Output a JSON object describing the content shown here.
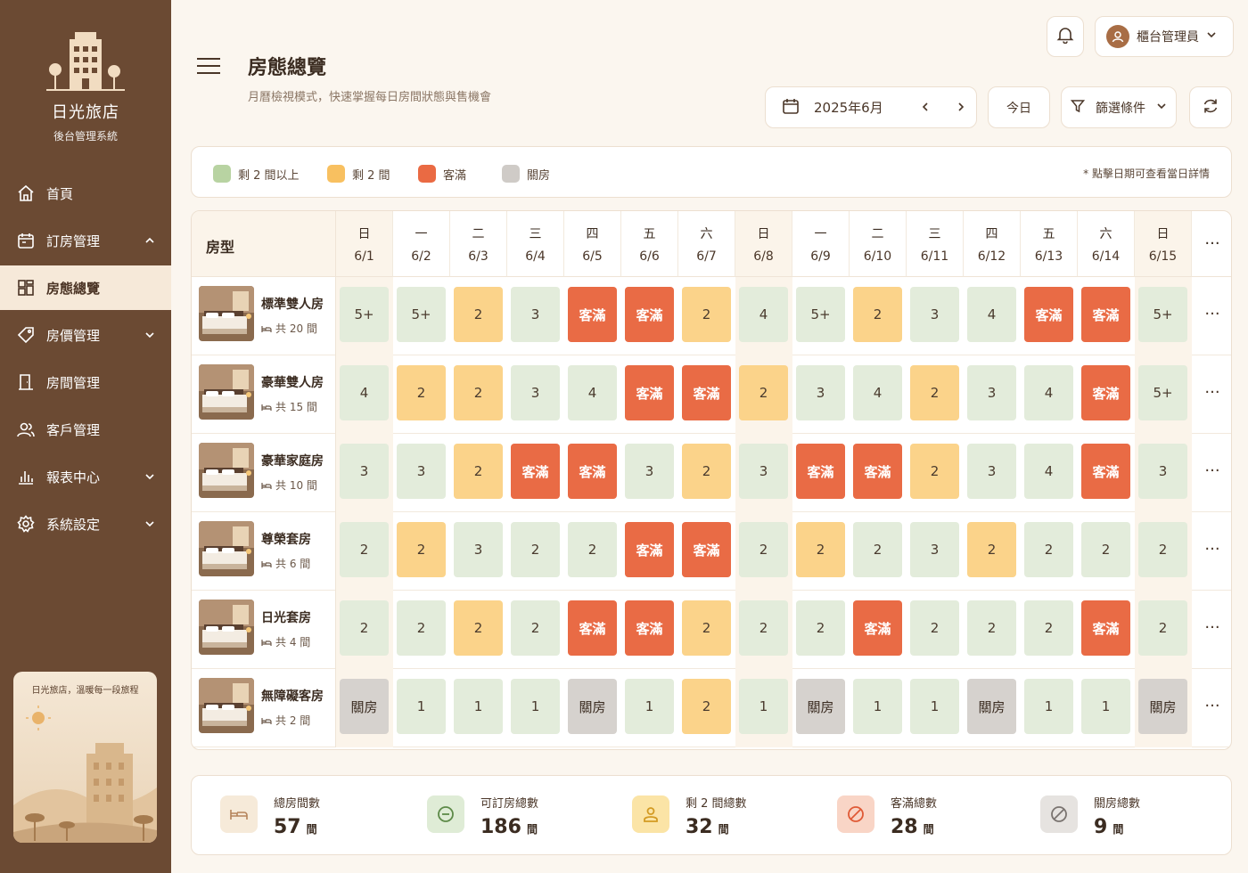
{
  "sidebar": {
    "brand_name": "日光旅店",
    "brand_sub": "後台管理系統",
    "items": [
      {
        "label": "首頁",
        "icon": "home-icon",
        "expand": false
      },
      {
        "label": "訂房管理",
        "icon": "calendar-icon",
        "expand": true
      },
      {
        "label": "房態總覽",
        "icon": "grid-icon",
        "active": true
      },
      {
        "label": "房價管理",
        "icon": "tag-icon",
        "expand": true
      },
      {
        "label": "房間管理",
        "icon": "door-icon",
        "expand": false
      },
      {
        "label": "客戶管理",
        "icon": "users-icon",
        "expand": false
      },
      {
        "label": "報表中心",
        "icon": "chart-icon",
        "expand": true
      },
      {
        "label": "系統設定",
        "icon": "gear-icon",
        "expand": true
      }
    ],
    "promo_text": "日光旅店，溫暖每一段旅程"
  },
  "header": {
    "title": "房態總覽",
    "subtitle": "月曆檢視模式，快速掌握每日房間狀態與售機會",
    "user_name": "櫃台管理員",
    "month": "2025年6月",
    "today_label": "今日",
    "filter_label": "篩選條件"
  },
  "legend": {
    "items": [
      {
        "label": "剩 2 間以上",
        "color": "#b8d3a2"
      },
      {
        "label": "剩 2 間",
        "color": "#f8c060"
      },
      {
        "label": "客滿",
        "color": "#ea6a43"
      },
      {
        "label": "關房",
        "color": "#cfcbc7"
      }
    ],
    "note": "* 點擊日期可查看當日詳情"
  },
  "grid": {
    "room_type_header": "房型",
    "days": [
      {
        "weekday": "日",
        "date": "6/1"
      },
      {
        "weekday": "一",
        "date": "6/2"
      },
      {
        "weekday": "二",
        "date": "6/3"
      },
      {
        "weekday": "三",
        "date": "6/4"
      },
      {
        "weekday": "四",
        "date": "6/5"
      },
      {
        "weekday": "五",
        "date": "6/6"
      },
      {
        "weekday": "六",
        "date": "6/7"
      },
      {
        "weekday": "日",
        "date": "6/8"
      },
      {
        "weekday": "一",
        "date": "6/9"
      },
      {
        "weekday": "二",
        "date": "6/10"
      },
      {
        "weekday": "三",
        "date": "6/11"
      },
      {
        "weekday": "四",
        "date": "6/12"
      },
      {
        "weekday": "五",
        "date": "6/13"
      },
      {
        "weekday": "六",
        "date": "6/14"
      },
      {
        "weekday": "日",
        "date": "6/15"
      }
    ],
    "more": "···",
    "rooms": [
      {
        "name": "標準雙人房",
        "count": "共 20 間",
        "cells": [
          [
            "5+",
            "avail"
          ],
          [
            "5+",
            "avail"
          ],
          [
            "2",
            "low"
          ],
          [
            "3",
            "avail"
          ],
          [
            "客滿",
            "full"
          ],
          [
            "客滿",
            "full"
          ],
          [
            "2",
            "low"
          ],
          [
            "4",
            "avail"
          ],
          [
            "5+",
            "avail"
          ],
          [
            "2",
            "low"
          ],
          [
            "3",
            "avail"
          ],
          [
            "4",
            "avail"
          ],
          [
            "客滿",
            "full"
          ],
          [
            "客滿",
            "full"
          ],
          [
            "5+",
            "avail"
          ]
        ]
      },
      {
        "name": "豪華雙人房",
        "count": "共 15 間",
        "cells": [
          [
            "4",
            "avail"
          ],
          [
            "2",
            "low"
          ],
          [
            "2",
            "low"
          ],
          [
            "3",
            "avail"
          ],
          [
            "4",
            "avail"
          ],
          [
            "客滿",
            "full"
          ],
          [
            "客滿",
            "full"
          ],
          [
            "2",
            "low"
          ],
          [
            "3",
            "avail"
          ],
          [
            "4",
            "avail"
          ],
          [
            "2",
            "low"
          ],
          [
            "3",
            "avail"
          ],
          [
            "4",
            "avail"
          ],
          [
            "客滿",
            "full"
          ],
          [
            "5+",
            "avail"
          ]
        ]
      },
      {
        "name": "豪華家庭房",
        "count": "共 10 間",
        "cells": [
          [
            "3",
            "avail"
          ],
          [
            "3",
            "avail"
          ],
          [
            "2",
            "low"
          ],
          [
            "客滿",
            "full"
          ],
          [
            "客滿",
            "full"
          ],
          [
            "3",
            "avail"
          ],
          [
            "2",
            "low"
          ],
          [
            "3",
            "avail"
          ],
          [
            "客滿",
            "full"
          ],
          [
            "客滿",
            "full"
          ],
          [
            "2",
            "low"
          ],
          [
            "3",
            "avail"
          ],
          [
            "4",
            "avail"
          ],
          [
            "客滿",
            "full"
          ],
          [
            "3",
            "avail"
          ]
        ]
      },
      {
        "name": "尊榮套房",
        "count": "共 6 間",
        "cells": [
          [
            "2",
            "avail"
          ],
          [
            "2",
            "low"
          ],
          [
            "3",
            "avail"
          ],
          [
            "2",
            "avail"
          ],
          [
            "2",
            "avail"
          ],
          [
            "客滿",
            "full"
          ],
          [
            "客滿",
            "full"
          ],
          [
            "2",
            "avail"
          ],
          [
            "2",
            "low"
          ],
          [
            "2",
            "avail"
          ],
          [
            "3",
            "avail"
          ],
          [
            "2",
            "low"
          ],
          [
            "2",
            "avail"
          ],
          [
            "2",
            "avail"
          ],
          [
            "2",
            "avail"
          ]
        ]
      },
      {
        "name": "日光套房",
        "count": "共 4 間",
        "cells": [
          [
            "2",
            "avail"
          ],
          [
            "2",
            "avail"
          ],
          [
            "2",
            "low"
          ],
          [
            "2",
            "avail"
          ],
          [
            "客滿",
            "full"
          ],
          [
            "客滿",
            "full"
          ],
          [
            "2",
            "low"
          ],
          [
            "2",
            "avail"
          ],
          [
            "2",
            "avail"
          ],
          [
            "客滿",
            "full"
          ],
          [
            "2",
            "avail"
          ],
          [
            "2",
            "avail"
          ],
          [
            "2",
            "avail"
          ],
          [
            "客滿",
            "full"
          ],
          [
            "2",
            "avail"
          ]
        ]
      },
      {
        "name": "無障礙客房",
        "count": "共 2 間",
        "cells": [
          [
            "關房",
            "closed"
          ],
          [
            "1",
            "avail"
          ],
          [
            "1",
            "avail"
          ],
          [
            "1",
            "avail"
          ],
          [
            "關房",
            "closed"
          ],
          [
            "1",
            "avail"
          ],
          [
            "2",
            "low"
          ],
          [
            "1",
            "avail"
          ],
          [
            "關房",
            "closed"
          ],
          [
            "1",
            "avail"
          ],
          [
            "1",
            "avail"
          ],
          [
            "關房",
            "closed"
          ],
          [
            "1",
            "avail"
          ],
          [
            "1",
            "avail"
          ],
          [
            "關房",
            "closed"
          ]
        ]
      }
    ]
  },
  "stats": [
    {
      "label": "總房間數",
      "value": "57",
      "unit": "間",
      "icon": "bed-icon",
      "bg": "#f6ead9",
      "fg": "#b5835a"
    },
    {
      "label": "可訂房總數",
      "value": "186",
      "unit": "間",
      "icon": "minus-circle-icon",
      "bg": "#dfecd6",
      "fg": "#5d8a48"
    },
    {
      "label": "剩 2 間總數",
      "value": "32",
      "unit": "間",
      "icon": "user-icon",
      "bg": "#fbe4a6",
      "fg": "#d39a22"
    },
    {
      "label": "客滿總數",
      "value": "28",
      "unit": "間",
      "icon": "ban-icon",
      "bg": "#f9d5c6",
      "fg": "#e05a36"
    },
    {
      "label": "關房總數",
      "value": "9",
      "unit": "間",
      "icon": "ban-icon",
      "bg": "#e6e3e0",
      "fg": "#7a7470"
    }
  ]
}
